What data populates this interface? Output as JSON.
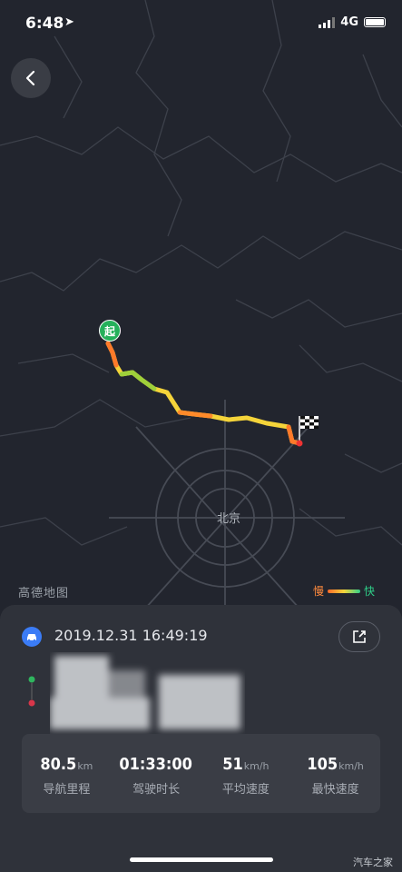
{
  "status_bar": {
    "time": "6:48",
    "network": "4G",
    "location_glyph": "➤"
  },
  "map": {
    "provider_logo": "高德地图",
    "city_label": "北京",
    "legend": {
      "slow": "慢",
      "fast": "快"
    },
    "start_marker": "起",
    "colors": {
      "slow": "#ff6a2a",
      "mid": "#f5d43a",
      "fast": "#2fd089",
      "background": "#22252e"
    }
  },
  "trip": {
    "datetime": "2019.12.31 16:49:19",
    "stats": [
      {
        "value": "80.5",
        "unit": "km",
        "label": "导航里程"
      },
      {
        "value": "01:33:00",
        "unit": "",
        "label": "驾驶时长"
      },
      {
        "value": "51",
        "unit": "km/h",
        "label": "平均速度"
      },
      {
        "value": "105",
        "unit": "km/h",
        "label": "最快速度"
      }
    ]
  },
  "watermark": "汽车之家"
}
